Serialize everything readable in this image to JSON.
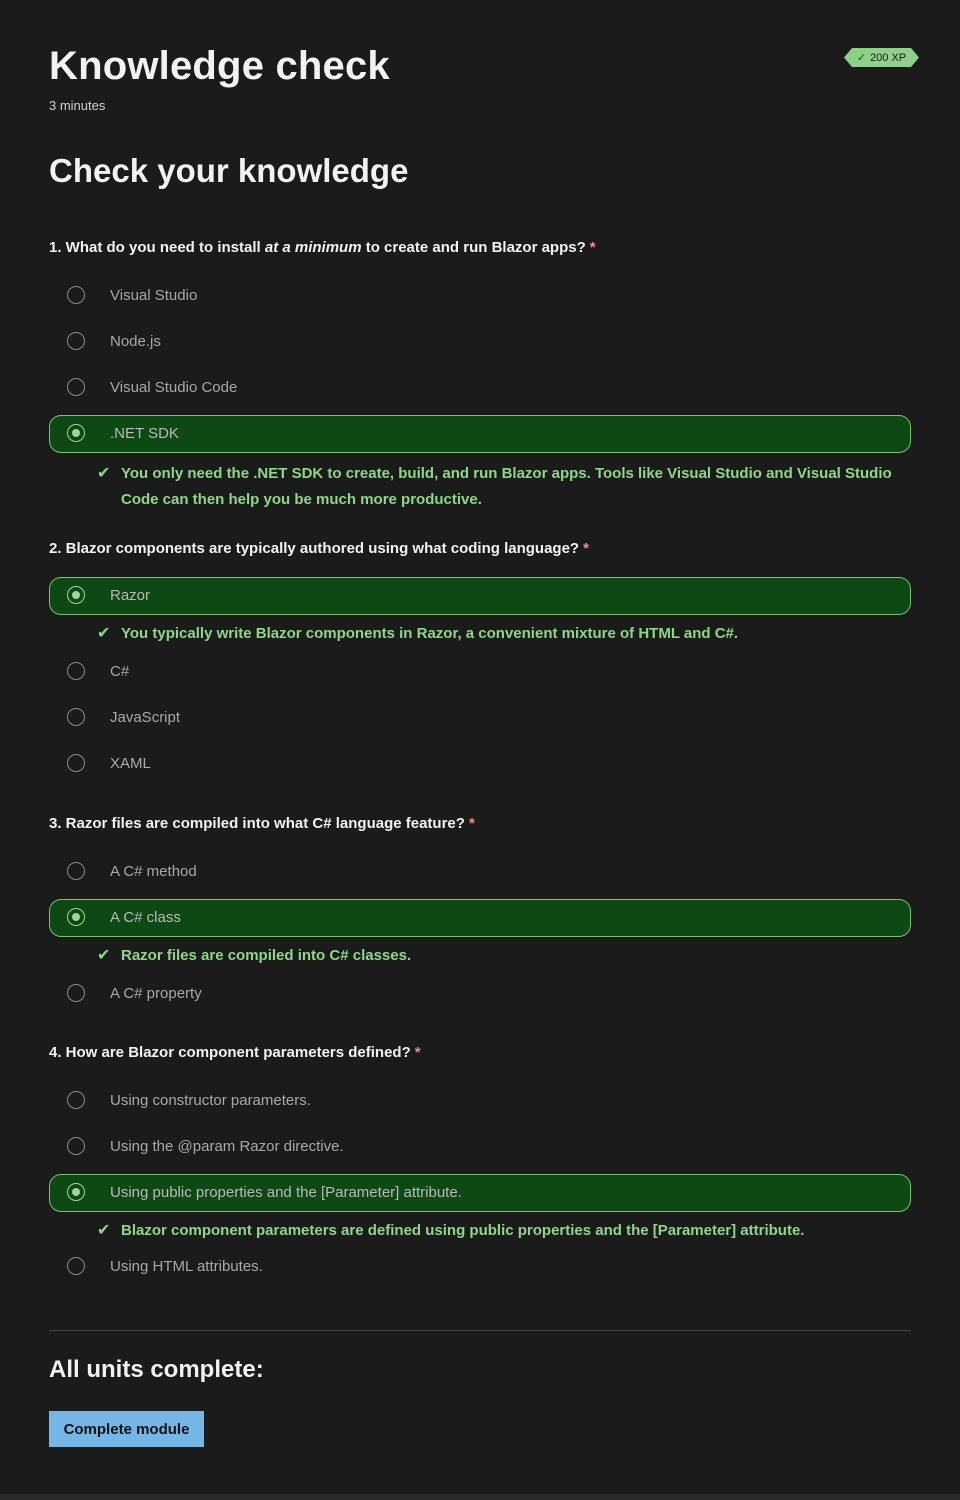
{
  "header": {
    "title": "Knowledge check",
    "duration": "3 minutes",
    "xp": "200 XP"
  },
  "section_title": "Check your knowledge",
  "questions": [
    {
      "label_pre": "1. What do you need to install ",
      "label_em": "at a minimum",
      "label_post": " to create and run Blazor apps?",
      "required": "*",
      "options": [
        "Visual Studio",
        "Node.js",
        "Visual Studio Code",
        ".NET SDK"
      ],
      "selected": ".NET SDK",
      "feedback": "You only need the .NET SDK to create, build, and run Blazor apps. Tools like Visual Studio and Visual Studio Code can then help you be much more productive."
    },
    {
      "label": "2. Blazor components are typically authored using what coding language?",
      "required": "*",
      "options": [
        "Razor",
        "C#",
        "JavaScript",
        "XAML"
      ],
      "selected": "Razor",
      "feedback": "You typically write Blazor components in Razor, a convenient mixture of HTML and C#."
    },
    {
      "label": "3. Razor files are compiled into what C# language feature?",
      "required": "*",
      "options": [
        "A C# method",
        "A C# class",
        "A C# property"
      ],
      "selected": "A C# class",
      "feedback": "Razor files are compiled into C# classes."
    },
    {
      "label": "4. How are Blazor component parameters defined?",
      "required": "*",
      "options": [
        "Using constructor parameters.",
        "Using the @param Razor directive.",
        "Using public properties and the [Parameter] attribute.",
        "Using HTML attributes."
      ],
      "selected": "Using public properties and the [Parameter] attribute.",
      "feedback": "Blazor component parameters are defined using public properties and the [Parameter] attribute."
    }
  ],
  "footer": {
    "complete_title": "All units complete:",
    "complete_button": "Complete module"
  },
  "colors": {
    "background": "#1b1b1b",
    "correct_fill": "#0e4814",
    "correct_border": "#7ac06d",
    "feedback_text": "#8fd68a",
    "button": "#75b6e7"
  },
  "icons": {
    "checkmark": "checkmark-icon",
    "radio": "radio-icon"
  }
}
